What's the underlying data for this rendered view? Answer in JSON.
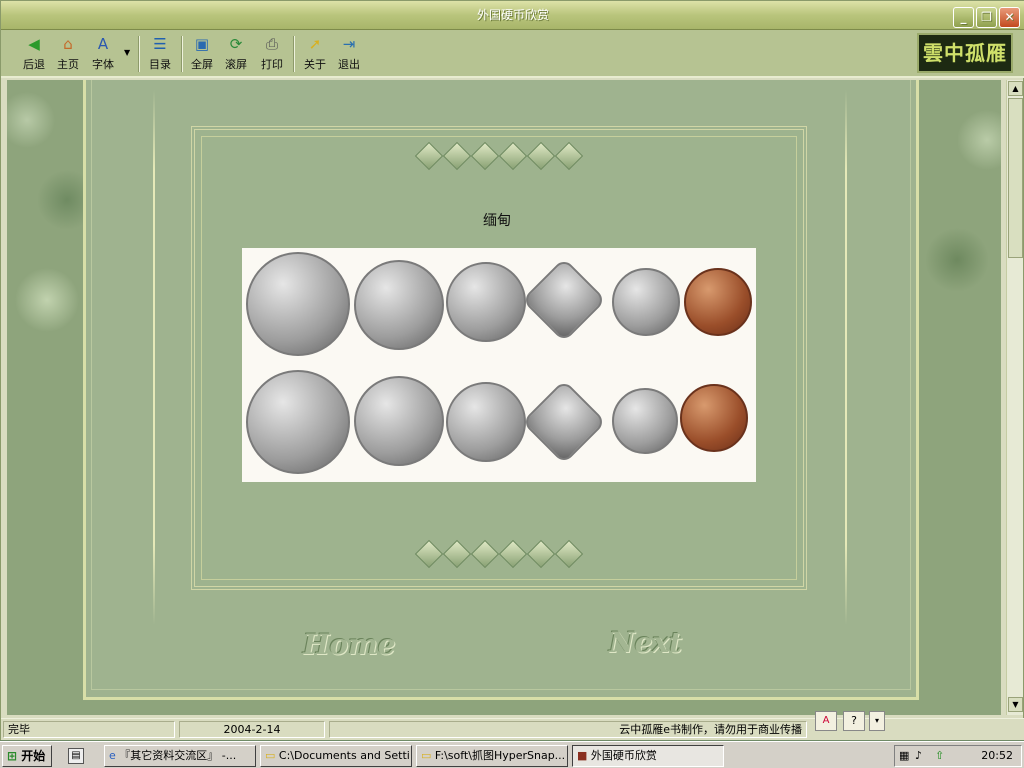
{
  "window": {
    "title": "外国硬币欣赏"
  },
  "toolbar": {
    "back": "后退",
    "home": "主页",
    "font": "字体",
    "toc": "目录",
    "fullscreen": "全屏",
    "scroll": "滚屏",
    "print": "打印",
    "about": "关于",
    "exit": "退出"
  },
  "logo": {
    "text": "雲中孤雁"
  },
  "content": {
    "title": "缅甸",
    "nav_home": "Home",
    "nav_next": "Next"
  },
  "status": {
    "left": "完毕",
    "date": "2004-2-14",
    "right": "云中孤雁e书制作，请勿用于商业传播"
  },
  "taskbar": {
    "start": "开始",
    "items": [
      "『其它资料交流区』 -...",
      "C:\\Documents and Setti...",
      "F:\\soft\\抓图HyperSnap...",
      "外国硬币欣赏"
    ],
    "time": "20:52"
  }
}
